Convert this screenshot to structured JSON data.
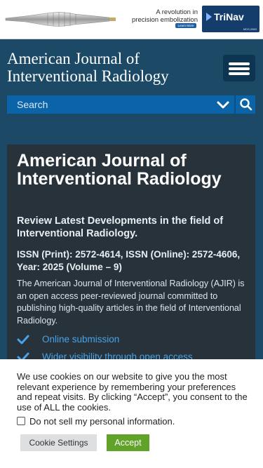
{
  "ad": {
    "headline_line1": "A revolution in",
    "headline_line2": "precision embolization",
    "cta": "Learn More",
    "brand": "TriNav",
    "brand_sub": "MDS-0583"
  },
  "header": {
    "site_title": "American Journal of Interventional Radiology",
    "search_placeholder": "Search"
  },
  "main": {
    "title": "American Journal of Interventional Radiology",
    "subtitle": "Review Latest Developments in the field of Interventional Radiology.",
    "issn": "ISSN (Print): 2572-4614, ISSN (Online): 2572-4606, Year: 2025 (Volume – 9)",
    "description": "The American Journal of Interventional Radiology (AJIR) is an open access peer-reviewed journal committed to publishing high-quality articles in the field of Interventional Radiology.",
    "features": [
      "Online submission",
      "Wider visibility through open access"
    ]
  },
  "cookie": {
    "message": "We use cookies on our website to give you the most relevant experience by remembering your preferences and repeat visits. By clicking “Accept”, you consent to the use of ALL the cookies.",
    "checkbox_label": "Do not sell my personal information.",
    "settings_label": "Cookie Settings",
    "accept_label": "Accept"
  },
  "colors": {
    "header_bg": "#1c4a66",
    "search_bg": "#0b64a8",
    "card_bg": "#27323a",
    "feature_link": "#4aa3e6",
    "accept_bg": "#61a229"
  }
}
